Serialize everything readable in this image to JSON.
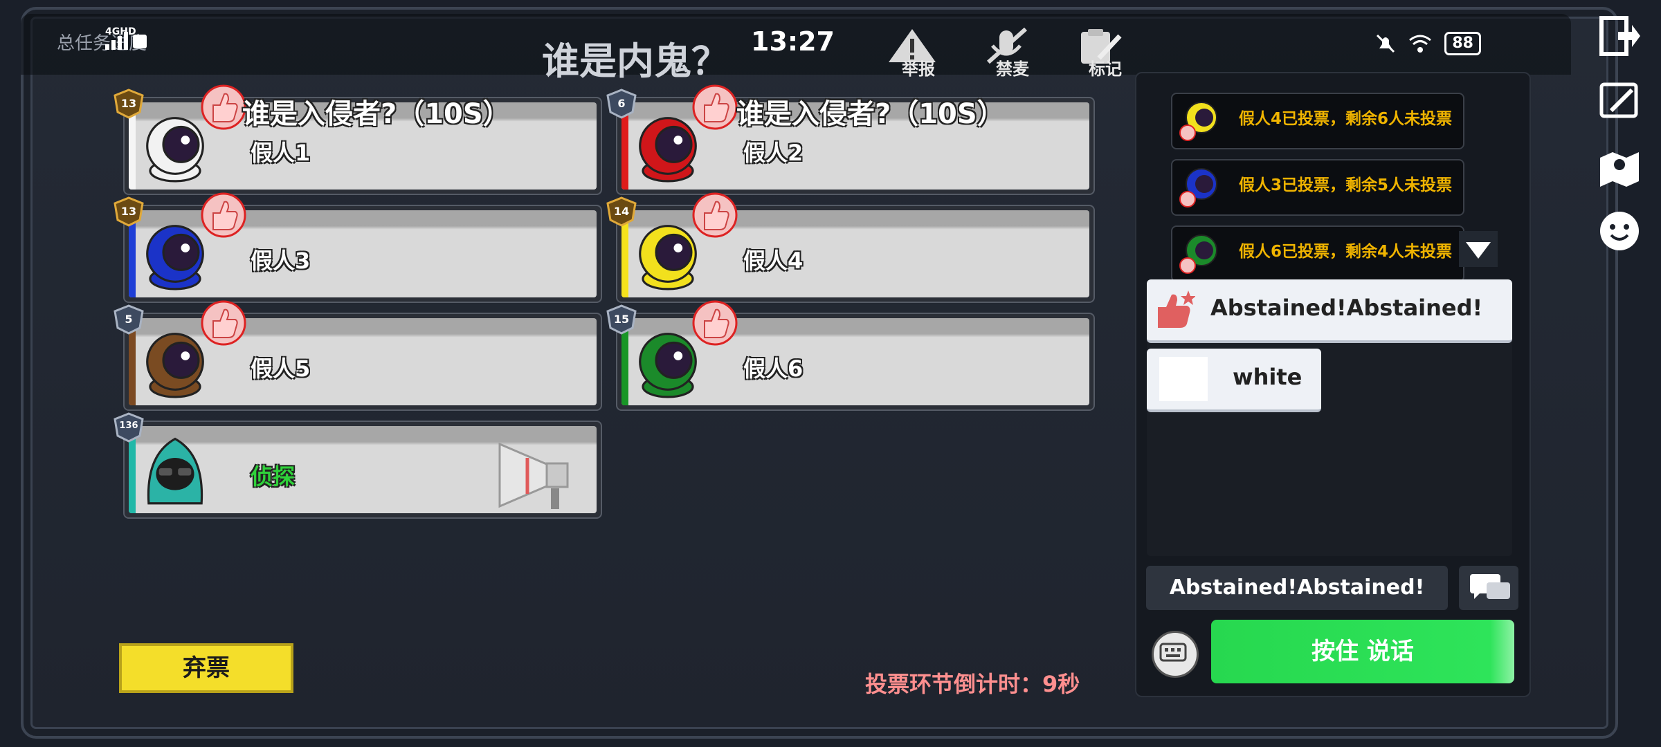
{
  "background": {
    "task_label": "总任务进度"
  },
  "status_bar": {
    "network": "4GHD",
    "time": "13:27",
    "battery": "88"
  },
  "title": "谁是内鬼？",
  "tools": [
    {
      "label": "举报",
      "icon": "warning-icon"
    },
    {
      "label": "禁麦",
      "icon": "mic-mute-icon"
    },
    {
      "label": "标记",
      "icon": "clipboard-pen-icon"
    }
  ],
  "vote_title": "谁是入侵者?（10S）",
  "players": [
    {
      "name": "假人1",
      "level": "13",
      "color": "#f2f2f2",
      "stripe": "#f5f5f5",
      "badge": "gold",
      "voted": true
    },
    {
      "name": "假人2",
      "level": "6",
      "color": "#d0161a",
      "stripe": "#e01b1b",
      "badge": "silver",
      "voted": true
    },
    {
      "name": "假人3",
      "level": "13",
      "color": "#1b33c8",
      "stripe": "#1f3fd6",
      "badge": "gold",
      "voted": true
    },
    {
      "name": "假人4",
      "level": "14",
      "color": "#f2e01d",
      "stripe": "#f5e21c",
      "badge": "gold",
      "voted": true
    },
    {
      "name": "假人5",
      "level": "5",
      "color": "#7a4b22",
      "stripe": "#7c4a22",
      "badge": "silver",
      "voted": true
    },
    {
      "name": "假人6",
      "level": "15",
      "color": "#1b8a2a",
      "stripe": "#189626",
      "badge": "silver",
      "voted": true
    },
    {
      "name": "侦探",
      "level": "136",
      "color": "#2bb3a6",
      "stripe": "#21b8a8",
      "badge": "silver",
      "voted": false
    }
  ],
  "abstain_label": "弃票",
  "countdown": "投票环节倒计时：9秒",
  "vote_log": [
    {
      "text": "假人4已投票，剩余6人未投票",
      "color": "#f2e01d"
    },
    {
      "text": "假人3已投票，剩余5人未投票",
      "color": "#1b33c8"
    },
    {
      "text": "假人6已投票，剩余4人未投票",
      "color": "#1b8a2a"
    }
  ],
  "quick_menu": [
    {
      "label": "Abstained!Abstained!"
    },
    {
      "label": "white"
    }
  ],
  "chat_input": "Abstained!Abstained!",
  "talk_button": "按住 说话",
  "colors": {
    "accent_green": "#2ee45a",
    "warning_yellow": "#f4de2a",
    "countdown_red": "#ff8f8f"
  }
}
